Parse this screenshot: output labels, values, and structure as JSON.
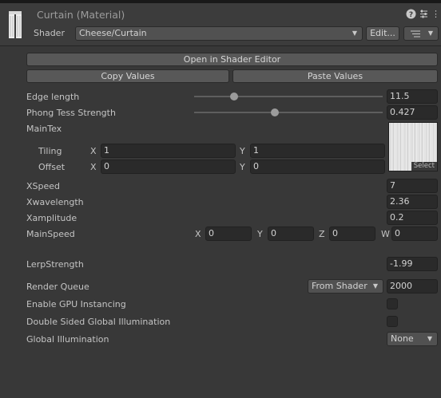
{
  "header": {
    "title": "Curtain (Material)",
    "shader_label": "Shader",
    "shader_value": "Cheese/Curtain",
    "edit_button": "Edit...",
    "help_icon": "?",
    "settings_icon": "sliders-icon",
    "more_icon": "⋮"
  },
  "buttons": {
    "open_editor": "Open in Shader Editor",
    "copy_values": "Copy Values",
    "paste_values": "Paste Values"
  },
  "properties": {
    "edge_length": {
      "label": "Edge length",
      "value": "11.5",
      "slider_fraction": 0.21
    },
    "phong": {
      "label": "Phong Tess Strength",
      "value": "0.427",
      "slider_fraction": 0.43
    },
    "maintex": {
      "label": "MainTex",
      "select_label": "Select"
    },
    "tiling": {
      "label": "Tiling",
      "x_label": "X",
      "x": "1",
      "y_label": "Y",
      "y": "1"
    },
    "offset": {
      "label": "Offset",
      "x_label": "X",
      "x": "0",
      "y_label": "Y",
      "y": "0"
    },
    "xspeed": {
      "label": "XSpeed",
      "value": "7"
    },
    "xwavelength": {
      "label": "Xwavelength",
      "value": "2.36"
    },
    "xamplitude": {
      "label": "Xamplitude",
      "value": "0.2"
    },
    "mainspeed": {
      "label": "MainSpeed",
      "x_label": "X",
      "x": "0",
      "y_label": "Y",
      "y": "0",
      "z_label": "Z",
      "z": "0",
      "w_label": "W",
      "w": "0"
    },
    "lerp": {
      "label": "LerpStrength",
      "value": "-1.99"
    }
  },
  "render": {
    "queue_label": "Render Queue",
    "queue_mode": "From Shader",
    "queue_value": "2000",
    "gpu_instancing": {
      "label": "Enable GPU Instancing",
      "checked": false
    },
    "double_sided_gi": {
      "label": "Double Sided Global Illumination",
      "checked": false
    },
    "gi": {
      "label": "Global Illumination",
      "value": "None"
    }
  }
}
